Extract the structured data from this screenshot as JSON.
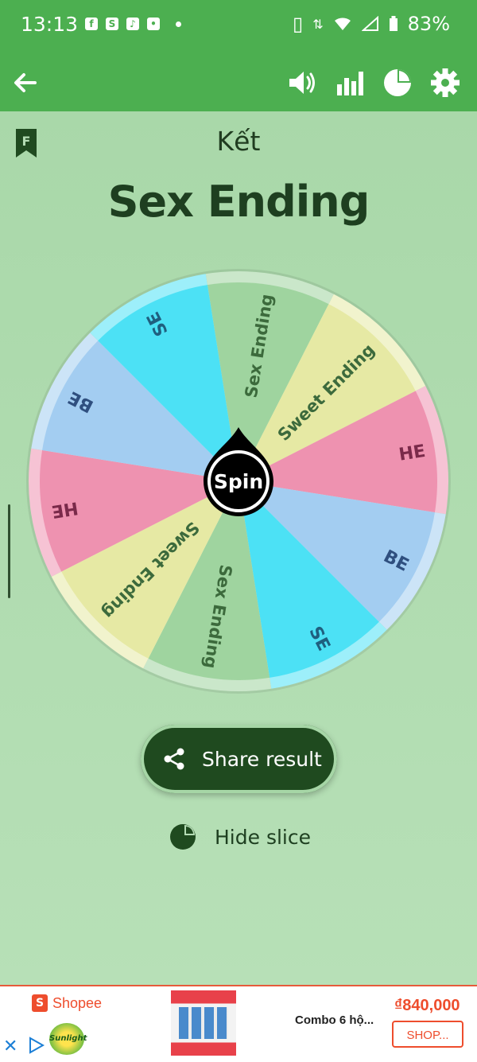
{
  "status_bar": {
    "time": "13:13",
    "battery": "83%"
  },
  "app_bar": {
    "icons": [
      "back-arrow-icon",
      "volume-icon",
      "bar-chart-icon",
      "pie-chart-icon",
      "gear-icon"
    ]
  },
  "header": {
    "subtitle": "Kết",
    "result": "Sex Ending"
  },
  "wheel": {
    "spin_label": "Spin",
    "slices": [
      {
        "label": "Sex Ending",
        "color": "#9fd49f"
      },
      {
        "label": "Sweet Ending",
        "color": "#e6e9a4"
      },
      {
        "label": "HE",
        "color": "#ee92b0"
      },
      {
        "label": "BE",
        "color": "#a3cdf1"
      },
      {
        "label": "SE",
        "color": "#4ce1f5"
      },
      {
        "label": "Sex Ending",
        "color": "#9fd49f"
      },
      {
        "label": "Sweet Ending",
        "color": "#e6e9a4"
      },
      {
        "label": "HE",
        "color": "#ee92b0"
      },
      {
        "label": "BE",
        "color": "#a3cdf1"
      },
      {
        "label": "SE",
        "color": "#4ce1f5"
      }
    ]
  },
  "actions": {
    "share_label": "Share result",
    "hide_slice_label": "Hide slice"
  },
  "ad": {
    "brand": "Shopee",
    "sub_brand": "Sunlight",
    "product": "Combo 6 hộ...",
    "price": "₫840,000",
    "cta": "SHOP..."
  }
}
